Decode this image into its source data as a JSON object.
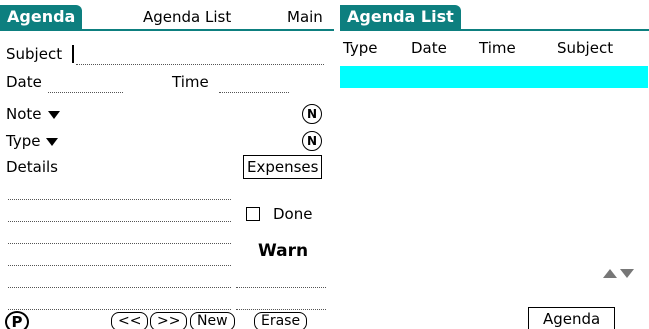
{
  "left_screen": {
    "title": "Agenda",
    "menu_items": [
      "Agenda List",
      "Main"
    ],
    "fields": {
      "subject_label": "Subject",
      "date_label": "Date",
      "time_label": "Time",
      "note_label": "Note",
      "type_label": "Type",
      "details_label": "Details"
    },
    "note_icon": "N",
    "type_icon": "N",
    "expenses_button": "Expenses",
    "done_label": "Done",
    "done_checked": false,
    "warn_label": "Warn",
    "bottom_bar": {
      "p_icon": "P",
      "buttons": [
        "<<",
        ">>",
        "New",
        "Erase"
      ]
    }
  },
  "right_screen": {
    "title": "Agenda List",
    "columns": [
      "Type",
      "Date",
      "Time",
      "Subject"
    ],
    "rows": [],
    "agenda_button": "Agenda",
    "colors": {
      "title_bg": "#0d7f7f",
      "selected_row": "#00ffff"
    }
  }
}
